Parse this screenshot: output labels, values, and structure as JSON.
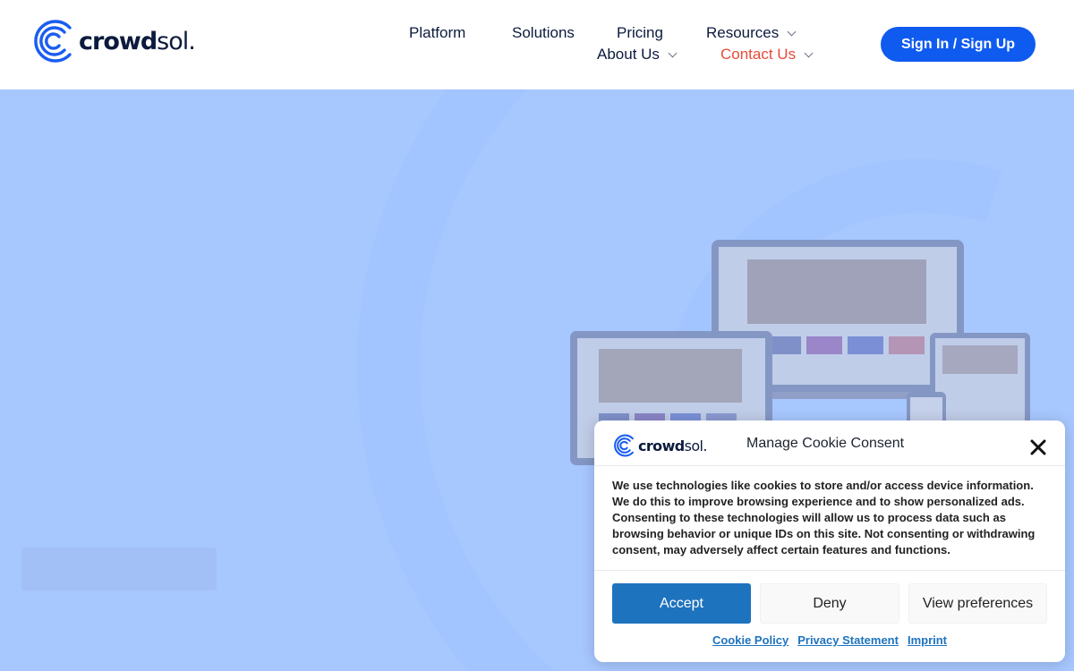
{
  "header": {
    "logo": {
      "brand_bold": "crowd",
      "brand_light": "sol.",
      "icon": "crowdsol-c-logo-icon"
    },
    "nav": {
      "platform": "Platform",
      "solutions": "Solutions",
      "pricing": "Pricing",
      "resources": "Resources",
      "about": "About Us",
      "contact": "Contact Us"
    },
    "signin_label": "Sign In / Sign Up"
  },
  "colors": {
    "brand_blue": "#0f5bf0",
    "active_nav": "#e84a3a",
    "hero_overlay": "#a7c7ff",
    "accept_button": "#1e73be"
  },
  "cookie": {
    "logo": {
      "brand_bold": "crowd",
      "brand_light": "sol."
    },
    "title": "Manage Cookie Consent",
    "close_icon": "close-icon",
    "body": "We use technologies like cookies to store and/or access device information. We do this to improve browsing experience and to show personalized ads. Consenting to these technologies will allow us to process data such as browsing behavior or unique IDs on this site. Not consenting or withdrawing consent, may adversely affect certain features and functions.",
    "buttons": {
      "accept": "Accept",
      "deny": "Deny",
      "preferences": "View preferences"
    },
    "links": {
      "cookie_policy": "Cookie Policy",
      "privacy": "Privacy Statement",
      "imprint": "Imprint"
    }
  }
}
